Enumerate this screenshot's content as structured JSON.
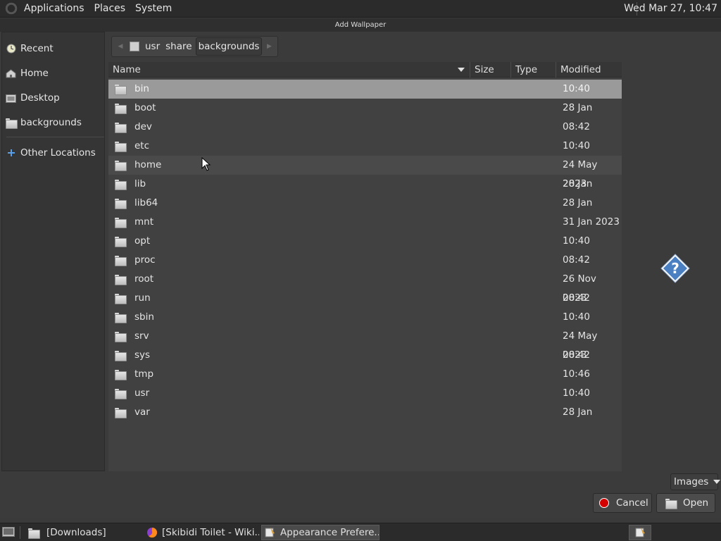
{
  "top_panel": {
    "menus": [
      "Applications",
      "Places",
      "System"
    ],
    "clock": "Wed Mar 27, 10:47"
  },
  "window": {
    "title": "Add Wallpaper"
  },
  "sidebar": {
    "items": [
      {
        "label": "Recent",
        "icon": "recent-icon"
      },
      {
        "label": "Home",
        "icon": "home-icon"
      },
      {
        "label": "Desktop",
        "icon": "desktop-icon"
      },
      {
        "label": "backgrounds",
        "icon": "folder-icon"
      },
      {
        "label": "Other Locations",
        "icon": "plus-icon"
      }
    ]
  },
  "pathbar": {
    "crumbs": [
      "usr",
      "share",
      "backgrounds"
    ]
  },
  "columns": {
    "name": "Name",
    "size": "Size",
    "type": "Type",
    "modified": "Modified"
  },
  "files": [
    {
      "name": "bin",
      "modified": "10:40"
    },
    {
      "name": "boot",
      "modified": "28 Jan"
    },
    {
      "name": "dev",
      "modified": "08:42"
    },
    {
      "name": "etc",
      "modified": "10:40"
    },
    {
      "name": "home",
      "modified": "24 May 2023"
    },
    {
      "name": "lib",
      "modified": "28 Jan"
    },
    {
      "name": "lib64",
      "modified": "28 Jan"
    },
    {
      "name": "mnt",
      "modified": "31 Jan 2023"
    },
    {
      "name": "opt",
      "modified": "10:40"
    },
    {
      "name": "proc",
      "modified": "08:42"
    },
    {
      "name": "root",
      "modified": "26 Nov 2023"
    },
    {
      "name": "run",
      "modified": "08:42"
    },
    {
      "name": "sbin",
      "modified": "10:40"
    },
    {
      "name": "srv",
      "modified": "24 May 2023"
    },
    {
      "name": "sys",
      "modified": "08:42"
    },
    {
      "name": "tmp",
      "modified": "10:46"
    },
    {
      "name": "usr",
      "modified": "10:40"
    },
    {
      "name": "var",
      "modified": "28 Jan"
    }
  ],
  "filter": {
    "selected": "Images"
  },
  "buttons": {
    "cancel": "Cancel",
    "open": "Open"
  },
  "taskbar": {
    "tasks": [
      "[Downloads]",
      "[Skibidi Toilet - Wiki...",
      "Appearance Prefere..."
    ]
  },
  "colors": {
    "selection": "#9a9a9a",
    "cancel_icon": "#d40000",
    "preview_icon": "#4a7fc1"
  }
}
